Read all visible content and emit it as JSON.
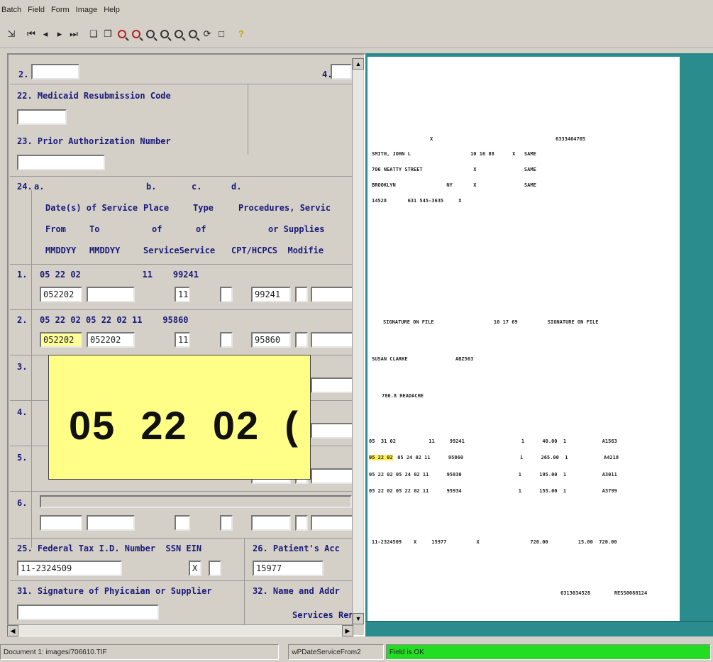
{
  "menu": [
    "Batch",
    "Field",
    "Form",
    "Image",
    "Help"
  ],
  "toolbar_icons": [
    "enter-icon",
    "first-icon",
    "prev-icon",
    "next-icon",
    "last-icon",
    "copy-left-icon",
    "copy-right-icon",
    "zoom-red-icon",
    "zoom-red-icon",
    "zoom-icon",
    "zoom-icon",
    "zoom-icon",
    "zoom-icon",
    "rotate-icon",
    "fit-icon",
    "help-icon"
  ],
  "form": {
    "f2_label": "2.",
    "f4_label": "4.",
    "f22_label": "22. Medicaid Resubmission Code",
    "f23_label": "23. Prior Authorization Number",
    "f24_label": "24.",
    "col_a": "a.",
    "col_b": "b.",
    "col_c": "c.",
    "col_d": "d.",
    "hdr_dates": "Date(s) of Service",
    "hdr_place": "Place",
    "hdr_type": "Type",
    "hdr_proc": "Procedures, Servic",
    "hdr_from": "From",
    "hdr_to": "To",
    "hdr_of1": "of",
    "hdr_of2": "of",
    "hdr_supplies": "or Supplies",
    "hdr_mmddyy1": "MMDDYY",
    "hdr_mmddyy2": "MMDDYY",
    "hdr_service": "ServiceService",
    "hdr_cpt": "CPT/HCPCS  Modifie",
    "lines": [
      {
        "num": "1.",
        "ocr": "05 22 02            11    99241",
        "from": "052202",
        "to": "",
        "place": "11",
        "type": "",
        "cpt": "99241"
      },
      {
        "num": "2.",
        "ocr": "05 22 02 05 22 02 11    95860",
        "from": "052202",
        "to": "052202",
        "place": "11",
        "type": "",
        "cpt": "95860"
      },
      {
        "num": "3.",
        "ocr": "",
        "from": "",
        "to": "",
        "place": "",
        "type": "",
        "cpt": ""
      },
      {
        "num": "4.",
        "ocr": "",
        "from": "",
        "to": "",
        "place": "",
        "type": "",
        "cpt": ""
      },
      {
        "num": "5.",
        "ocr": "",
        "from": "",
        "to": "",
        "place": "",
        "type": "",
        "cpt": ""
      },
      {
        "num": "6.",
        "ocr": "",
        "from": "",
        "to": "",
        "place": "",
        "type": "",
        "cpt": ""
      }
    ],
    "f25_label": "25. Federal Tax I.D. Number  SSN EIN",
    "f26_label": "26. Patient's Acc",
    "tax_id": "11-2324509",
    "ssn_check": "X",
    "patient_acct": "15977",
    "f31_label": "31. Signature of Phyicaian or Supplier",
    "f32_label": "32. Name and Addr",
    "f32_sub": "Services Rend"
  },
  "zoom_text": "05  22  02  (",
  "doc": {
    "l1": "X                                         6333464705",
    "l2": "SMITH, JOHN L                    10 16 88      X   SAME",
    "l3": "706 NEATTY STREET                 X                SAME",
    "l4": "BROOKLYN                 NY       X                SAME",
    "l5": "14528       631 545-3635     X",
    "sig": "SIGNATURE ON FILE                    10 17 69          SIGNATURE ON FILE",
    "ref": "SUSAN CLARKE                ABZ563",
    "diag": "780.8 HEADACHE",
    "s1": "05  31 02           11     99241                   1      40.00  1            A1563",
    "s2a": "05 22 02",
    "s2b": " 05 24 02 11      95860                   1      265.00  1            A4218",
    "s3": "05 22 02 05 24 02 11      95930                   1      195.00  1            A3011",
    "s4": "05 22 02 05 22 02 11      95934                   1      155.00  1            A3799",
    "tot": "11-2324509    X     15977          X                 720.00          15.00  720.00",
    "ftr": "6313034528        RESS0088124"
  },
  "status": {
    "document": "Document 1: images/706610.TIF",
    "field": "wPDateServiceFrom2",
    "result": "Field is OK"
  }
}
